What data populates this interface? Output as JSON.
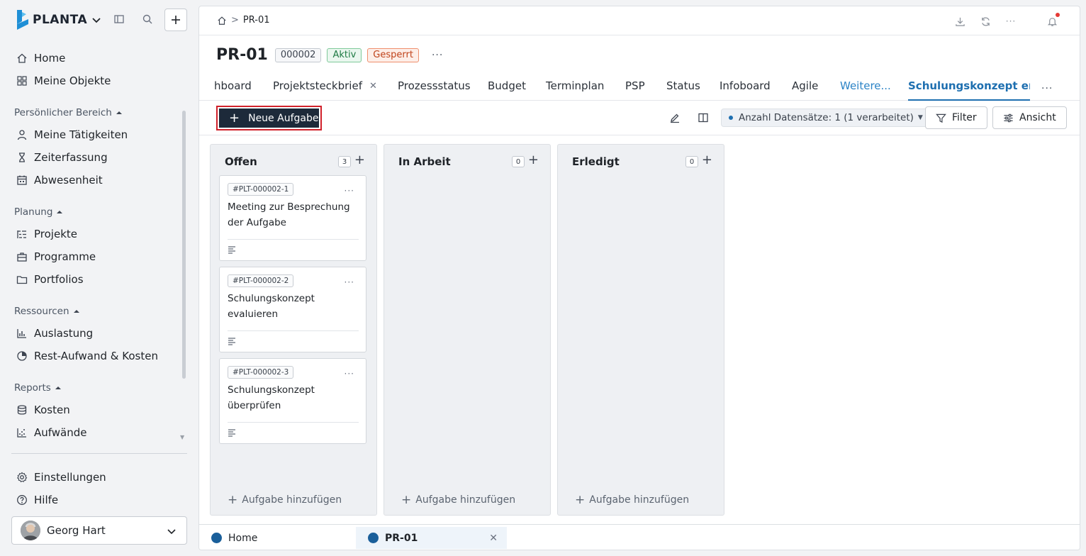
{
  "app": {
    "name": "PLANTA",
    "colors": {
      "brand": "#1d2a3a",
      "accent": "#1e6fb0",
      "highlight": "#d0202a"
    }
  },
  "sidebar": {
    "items_top": [
      {
        "label": "Home",
        "icon": "home-icon"
      },
      {
        "label": "Meine Objekte",
        "icon": "grid-icon"
      }
    ],
    "groups": [
      {
        "label": "Persönlicher Bereich",
        "items": [
          {
            "label": "Meine Tätigkeiten",
            "icon": "user-icon"
          },
          {
            "label": "Zeiterfassung",
            "icon": "hourglass-icon"
          },
          {
            "label": "Abwesenheit",
            "icon": "calendar-icon"
          }
        ]
      },
      {
        "label": "Planung",
        "items": [
          {
            "label": "Projekte",
            "icon": "project-list-icon"
          },
          {
            "label": "Programme",
            "icon": "briefcase-icon"
          },
          {
            "label": "Portfolios",
            "icon": "folder-icon"
          }
        ]
      },
      {
        "label": "Ressourcen",
        "items": [
          {
            "label": "Auslastung",
            "icon": "bar-chart-icon"
          },
          {
            "label": "Rest-Aufwand & Kosten",
            "icon": "pie-chart-icon"
          }
        ]
      },
      {
        "label": "Reports",
        "items": [
          {
            "label": "Kosten",
            "icon": "database-icon"
          },
          {
            "label": "Aufwände",
            "icon": "scatter-chart-icon"
          }
        ]
      }
    ],
    "bottom_items": [
      {
        "label": "Einstellungen",
        "icon": "gear-icon"
      },
      {
        "label": "Hilfe",
        "icon": "help-icon"
      }
    ],
    "user": {
      "name": "Georg Hart"
    }
  },
  "breadcrumb": {
    "current": "PR-01"
  },
  "header": {
    "title": "PR-01",
    "badges": {
      "id": "000002",
      "status_active": "Aktiv",
      "status_locked": "Gesperrt"
    },
    "more": "···"
  },
  "tabs": [
    {
      "label": "hboard"
    },
    {
      "label": "Projektsteckbrief",
      "closable": true
    },
    {
      "label": "Prozessstatus"
    },
    {
      "label": "Budget"
    },
    {
      "label": "Terminplan"
    },
    {
      "label": "PSP"
    },
    {
      "label": "Status"
    },
    {
      "label": "Infoboard"
    },
    {
      "label": "Agile"
    },
    {
      "label": "Weitere..."
    },
    {
      "label": "Schulungskonzept erstel",
      "active": true
    }
  ],
  "toolbar": {
    "new_task": "Neue Aufgabe",
    "records": "Anzahl Datensätze: 1 (1 verarbeitet)",
    "filter": "Filter",
    "view": "Ansicht"
  },
  "board": {
    "add_task": "Aufgabe hinzufügen",
    "columns": [
      {
        "title": "Offen",
        "count": "3",
        "cards": [
          {
            "id": "#PLT-000002-1",
            "title": "Meeting zur Besprechung der Aufgabe"
          },
          {
            "id": "#PLT-000002-2",
            "title": "Schulungskonzept evaluieren"
          },
          {
            "id": "#PLT-000002-3",
            "title": "Schulungskonzept überprüfen"
          }
        ]
      },
      {
        "title": "In Arbeit",
        "count": "0",
        "cards": []
      },
      {
        "title": "Erledigt",
        "count": "0",
        "cards": []
      }
    ]
  },
  "bottom_tabs": [
    {
      "label": "Home",
      "active": false
    },
    {
      "label": "PR-01",
      "active": true
    }
  ]
}
